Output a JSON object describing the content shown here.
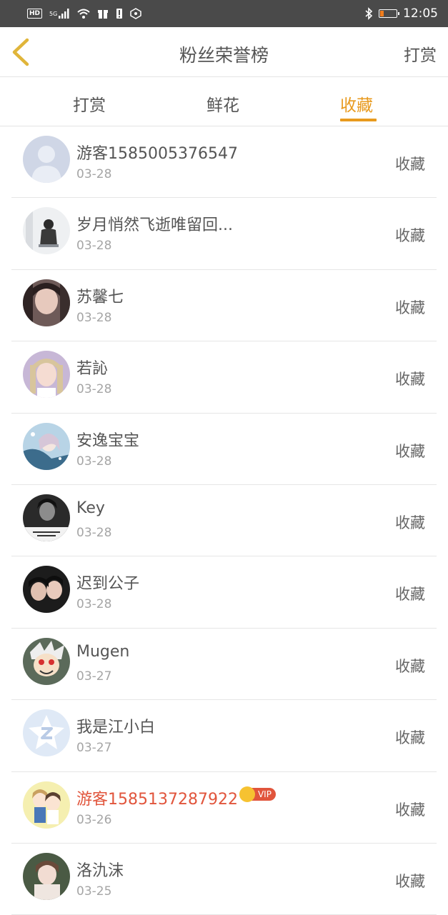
{
  "status_bar": {
    "network_badge": "HD",
    "network_type": "5G",
    "time": "12:05",
    "battery_level": 0.2,
    "battery_color": "#f07d1d"
  },
  "header": {
    "title": "粉丝荣誉榜",
    "action_label": "打赏",
    "back_icon": "chevron-left-icon",
    "back_color": "#e0b53a"
  },
  "tabs": [
    {
      "label": "打赏",
      "active": false
    },
    {
      "label": "鲜花",
      "active": false
    },
    {
      "label": "收藏",
      "active": true
    }
  ],
  "accent_color": "#e89a1e",
  "vip_color": "#e1553c",
  "fans": [
    {
      "name": "游客1585005376547",
      "date": "03-28",
      "action": "收藏",
      "avatar": "default-user-avatar"
    },
    {
      "name": "岁月悄然飞逝唯留回...",
      "date": "03-28",
      "action": "收藏",
      "avatar": "photo-avatar"
    },
    {
      "name": "苏馨七",
      "date": "03-28",
      "action": "收藏",
      "avatar": "photo-avatar"
    },
    {
      "name": "若訫",
      "date": "03-28",
      "action": "收藏",
      "avatar": "photo-avatar"
    },
    {
      "name": "安逸宝宝",
      "date": "03-28",
      "action": "收藏",
      "avatar": "anime-avatar"
    },
    {
      "name": "Key",
      "date": "03-28",
      "action": "收藏",
      "avatar": "photo-avatar"
    },
    {
      "name": "迟到公子",
      "date": "03-28",
      "action": "收藏",
      "avatar": "photo-avatar"
    },
    {
      "name": "Mugen",
      "date": "03-27",
      "action": "收藏",
      "avatar": "anime-avatar"
    },
    {
      "name": "我是江小白",
      "date": "03-27",
      "action": "收藏",
      "avatar": "qq-default-avatar"
    },
    {
      "name": "游客1585137287922",
      "date": "03-26",
      "action": "收藏",
      "avatar": "cartoon-avatar",
      "vip": true,
      "vip_label": "VIP"
    },
    {
      "name": "洛氿沫",
      "date": "03-25",
      "action": "收藏",
      "avatar": "photo-avatar"
    }
  ]
}
